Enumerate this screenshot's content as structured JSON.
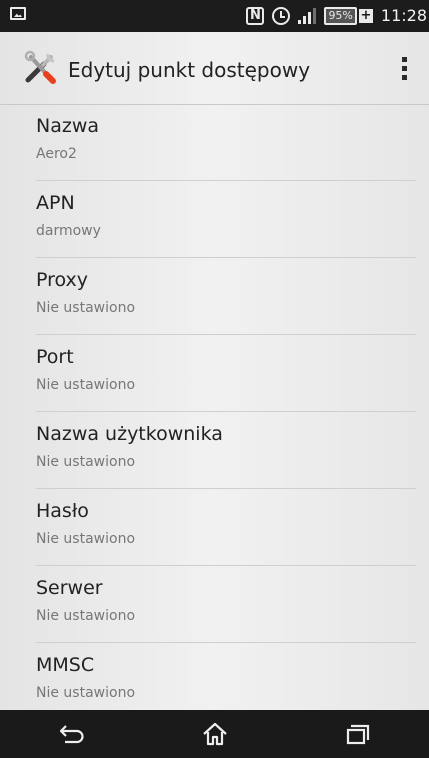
{
  "status_bar": {
    "nfc_label": "N",
    "battery_percent": "95%",
    "charging_symbol": "+",
    "time": "11:28"
  },
  "action_bar": {
    "title": "Edytuj punkt dostępowy",
    "app_icon": "tools-icon",
    "overflow_icon": "overflow-menu-icon"
  },
  "settings": [
    {
      "title": "Nazwa",
      "summary": "Aero2"
    },
    {
      "title": "APN",
      "summary": "darmowy"
    },
    {
      "title": "Proxy",
      "summary": "Nie ustawiono"
    },
    {
      "title": "Port",
      "summary": "Nie ustawiono"
    },
    {
      "title": "Nazwa użytkownika",
      "summary": "Nie ustawiono"
    },
    {
      "title": "Hasło",
      "summary": "Nie ustawiono"
    },
    {
      "title": "Serwer",
      "summary": "Nie ustawiono"
    },
    {
      "title": "MMSC",
      "summary": "Nie ustawiono"
    }
  ],
  "nav_bar": {
    "back_icon": "back-icon",
    "home_icon": "home-icon",
    "recents_icon": "recent-apps-icon"
  },
  "colors": {
    "status_bar_bg": "#1c1c1c",
    "nav_bar_bg": "#1a1a1a",
    "title_text": "#222222",
    "summary_text": "#777777",
    "divider": "#cfcfcf"
  }
}
